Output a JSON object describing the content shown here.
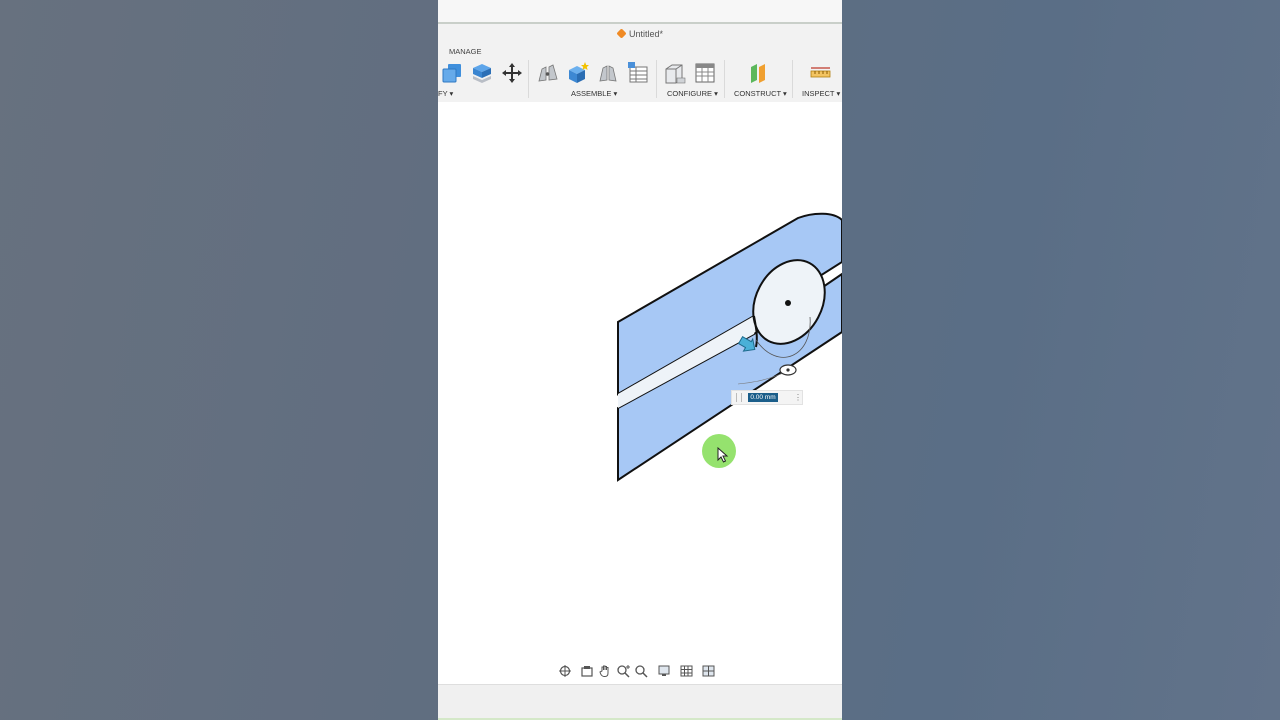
{
  "window": {
    "title": "Untitled*"
  },
  "toolbar": {
    "active_tab": "MANAGE",
    "groups": {
      "modify": "FY ▾",
      "assemble": "ASSEMBLE ▾",
      "configure": "CONFIGURE ▾",
      "construct": "CONSTRUCT ▾",
      "inspect": "INSPECT ▾"
    }
  },
  "viewport": {
    "dimension_input": {
      "value": "0.00 mm"
    },
    "dimension_menu": "⋮"
  },
  "colors": {
    "part_fill": "#a7c8f5",
    "outline": "#111111",
    "hole_fill": "#f1f6fb",
    "dimension_input_bg": "#1b5e8a",
    "cursor_highlight": "#8fe066",
    "doc_icon": "#f08a24"
  }
}
